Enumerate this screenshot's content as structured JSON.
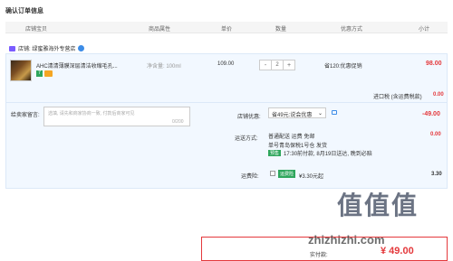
{
  "page_title": "确认订单信息",
  "headers": [
    "店铺宝贝",
    "商品属性",
    "单价",
    "数量",
    "优惠方式",
    "小计"
  ],
  "shop": {
    "label": "店铺: 绿蜜雅海外专营店"
  },
  "item": {
    "name": "AHC清清薄膜深层清洁收缩毛孔...",
    "spec": "净含量: 100ml",
    "badge": "7",
    "unit_price": "109.00",
    "quantity": "2",
    "minus": "-",
    "plus": "+",
    "promo": "省120:优惠促销",
    "subtotal": "98.00"
  },
  "tax": {
    "label": "进口税 (含运费税款)",
    "value": "0.00"
  },
  "message": {
    "label": "给卖家留言:",
    "placeholder": "选填, 请先和商家协商一致, 付款后商家可见",
    "count": "0/200"
  },
  "coupon": {
    "label": "店铺优惠:",
    "selected": "省49元:说会优惠",
    "value": "-49.00"
  },
  "shipping": {
    "label": "运送方式:",
    "line1": "普通配送 运费 免邮",
    "line2": "单号青岛保税1号仓 发货",
    "tag": "预售",
    "line3": "17:30前付款, 8月19日送达, 晚到必赔",
    "value": "0.00"
  },
  "insurance": {
    "label": "运费险:",
    "tag": "运费险",
    "text": "¥3.30元起",
    "value": "3.30"
  },
  "payment": {
    "label": "实付款:",
    "value": "¥ 49.00"
  },
  "watermark": {
    "big": "值值值",
    "small": "zhizhizhi.com"
  }
}
